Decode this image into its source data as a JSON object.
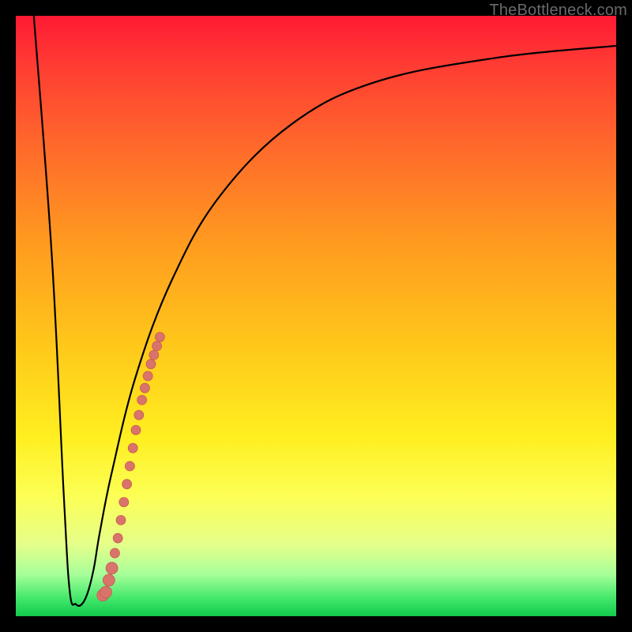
{
  "watermark": "TheBottleneck.com",
  "colors": {
    "curve": "#000000",
    "dots": "#d9746b",
    "dot_stroke": "#c85a52"
  },
  "chart_data": {
    "type": "line",
    "title": "",
    "xlabel": "",
    "ylabel": "",
    "xlim": [
      0,
      100
    ],
    "ylim": [
      0,
      100
    ],
    "grid": false,
    "legend": null,
    "series": [
      {
        "name": "bottleneck-curve",
        "x": [
          3,
          6,
          8,
          9,
          10,
          11,
          12,
          13,
          14,
          16,
          20,
          26,
          34,
          46,
          60,
          80,
          100
        ],
        "y": [
          100,
          60,
          20,
          4,
          2,
          2,
          4,
          8,
          14,
          24,
          40,
          56,
          70,
          82,
          89,
          93,
          95
        ]
      }
    ],
    "dots": {
      "name": "highlight-dots",
      "x": [
        14.5,
        15.0,
        15.5,
        16.0,
        16.5,
        17.0,
        17.5,
        18.0,
        18.5,
        19.0,
        19.5,
        20.0,
        20.5,
        21.0,
        21.5,
        22.0,
        22.5,
        23.0,
        23.5,
        24.0
      ],
      "y": [
        3.5,
        4.0,
        6.0,
        8.0,
        10.5,
        13.0,
        16.0,
        19.0,
        22.0,
        25.0,
        28.0,
        31.0,
        33.5,
        36.0,
        38.0,
        40.0,
        42.0,
        43.5,
        45.0,
        46.5
      ],
      "big_idx": [
        0,
        1,
        2,
        3
      ]
    }
  }
}
